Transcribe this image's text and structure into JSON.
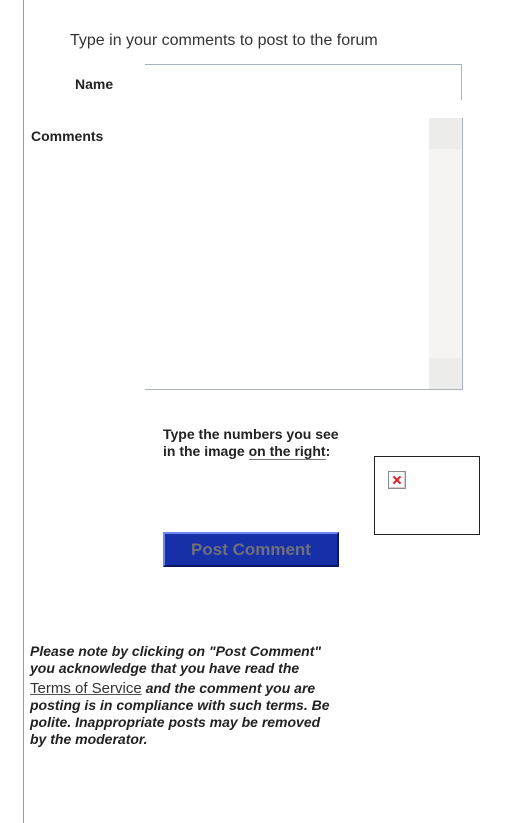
{
  "form": {
    "intro": "Type in your comments to post to the forum",
    "name_label": "Name",
    "name_value": "",
    "comments_label": "Comments",
    "comments_value": ""
  },
  "captcha": {
    "instructions_part1": "Type the numbers you see in the image ",
    "instructions_underlined": "on the right",
    "instructions_colon": ":",
    "image_icon": "broken-image-icon"
  },
  "actions": {
    "post_label": "Post Comment",
    "button_color": "#1730a8"
  },
  "notice": {
    "before_link": "Please note by clicking on \"Post Comment\" you acknowledge that you have read the",
    "link_text": "Terms of Service",
    "after_link": " and the comment you are posting is in compliance with such terms. Be polite. Inappropriate posts may be removed by the moderator."
  }
}
